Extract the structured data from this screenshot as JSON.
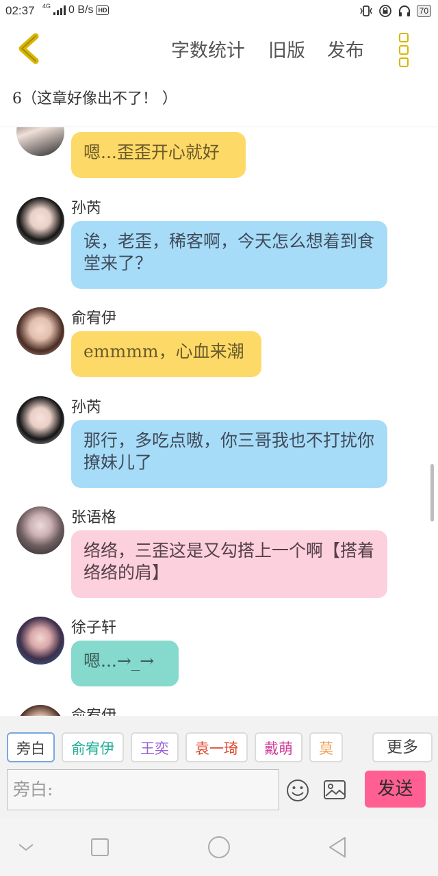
{
  "status_bar": {
    "time": "02:37",
    "network_label": "4G",
    "speed": "0 B/s",
    "hd_label": "HD",
    "battery": "70"
  },
  "toolbar": {
    "word_count": "字数统计",
    "old_version": "旧版",
    "publish": "发布"
  },
  "chapter_title": "6（这章好像出不了！ ）",
  "messages": [
    {
      "speaker": "",
      "text": "嗯...歪歪开心就好",
      "color": "#fdd967"
    },
    {
      "speaker": "孙芮",
      "text": "诶，老歪，稀客啊，今天怎么想着到食堂来了？",
      "color": "#a7dcf8"
    },
    {
      "speaker": "俞宥伊",
      "text": "emmmm，心血来潮",
      "color": "#fdd967"
    },
    {
      "speaker": "孙芮",
      "text": "那行，多吃点嗷，你三哥我也不打扰你撩妹儿了",
      "color": "#a7dcf8"
    },
    {
      "speaker": "张语格",
      "text": "络络，三歪这是又勾搭上一个啊【搭着络络的肩】",
      "color": "#fcd0dc"
    },
    {
      "speaker": "徐子轩",
      "text": "嗯...→_→",
      "color": "#86d9cd"
    },
    {
      "speaker": "俞宥伊",
      "text": "",
      "color": "#fdd967"
    }
  ],
  "characters": [
    {
      "label": "旁白",
      "color": "#444444"
    },
    {
      "label": "俞宥伊",
      "color": "#1fae97"
    },
    {
      "label": "王奕",
      "color": "#9c5fd6"
    },
    {
      "label": "袁一琦",
      "color": "#e0452c"
    },
    {
      "label": "戴萌",
      "color": "#cf3f9a"
    },
    {
      "label": "莫",
      "color": "#f0a050"
    }
  ],
  "more_label": "更多",
  "input": {
    "prefix": "旁白:"
  },
  "send_label": "发送",
  "icons": {
    "back": "chevron-left-icon",
    "more": "vertical-more-icon",
    "emoji": "smiley-icon",
    "image": "image-icon",
    "nav_back": "triangle-back-icon",
    "nav_home": "circle-home-icon",
    "nav_recent": "square-recent-icon",
    "nav_hide": "chevron-down-icon"
  }
}
